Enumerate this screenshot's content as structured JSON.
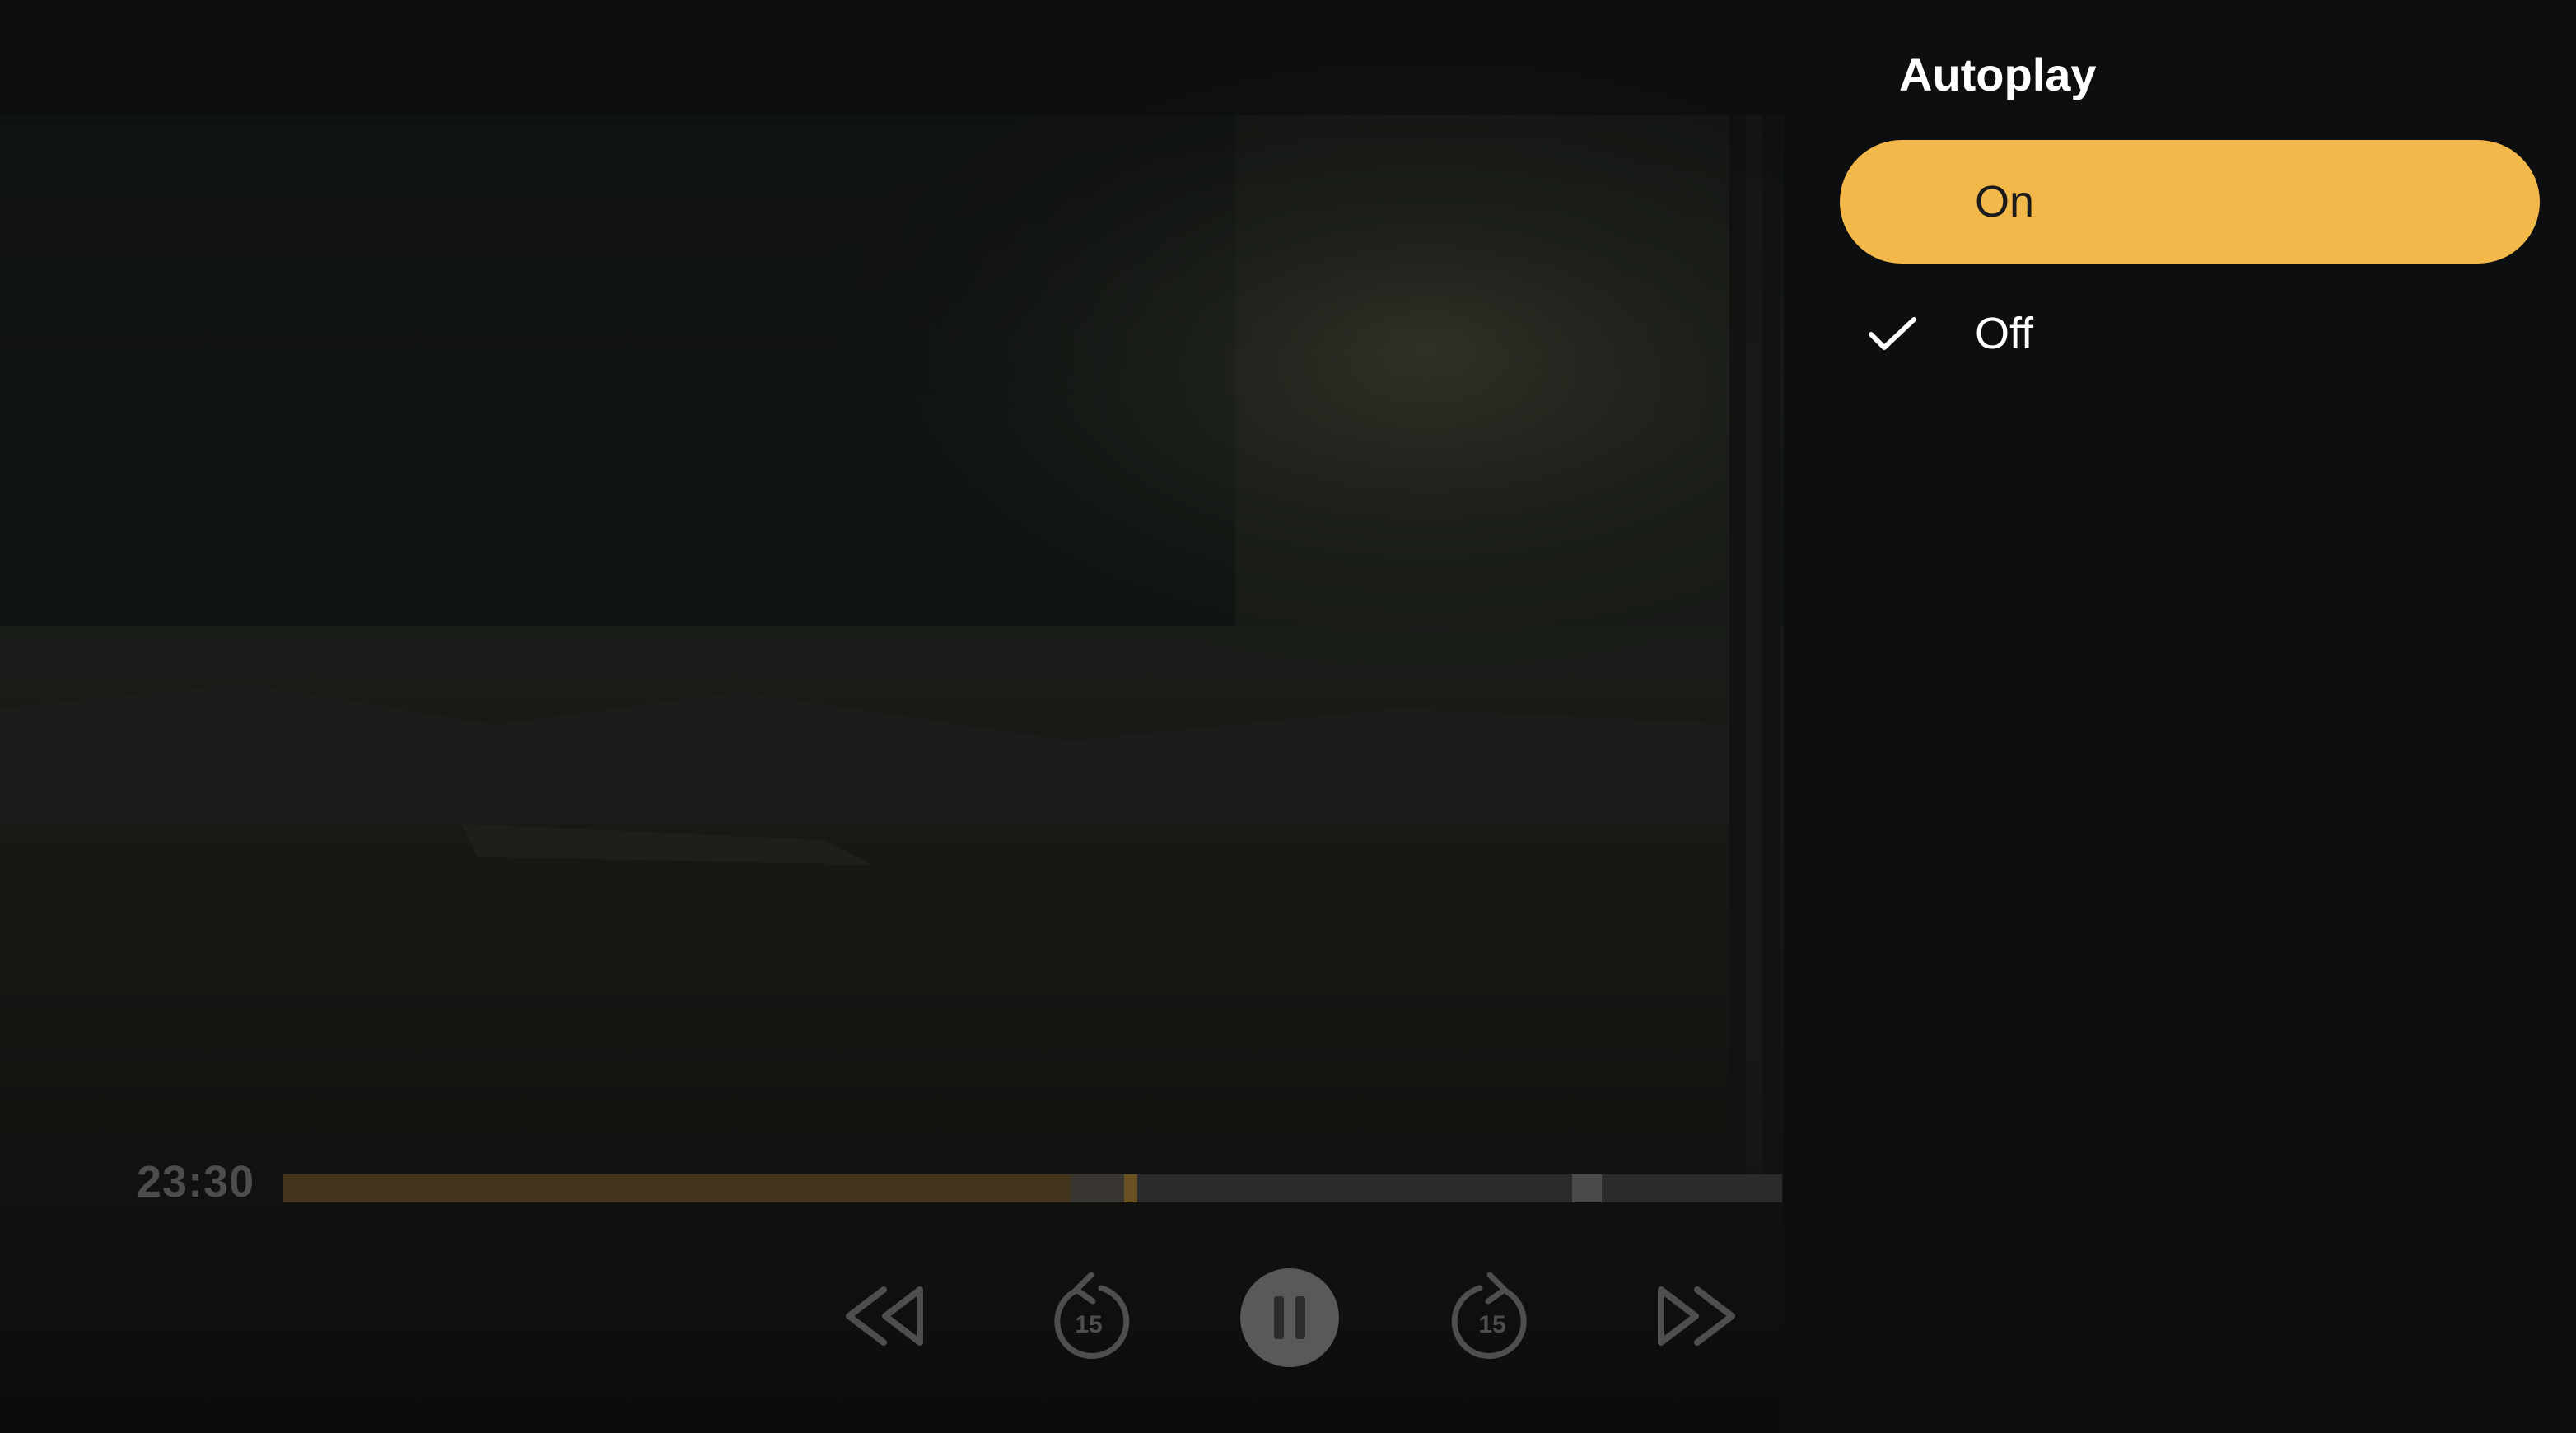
{
  "player": {
    "current_time": "23:30",
    "progress_fraction": 0.525,
    "buffered_fraction": 0.57,
    "marker_fraction": 0.86,
    "controls": {
      "rewind": "rewind-icon",
      "skip_back": "skip-back-15-icon",
      "skip_back_seconds": "15",
      "pause": "pause-icon",
      "skip_forward": "skip-forward-15-icon",
      "skip_forward_seconds": "15",
      "fast_forward": "fast-forward-icon"
    }
  },
  "autoplay_panel": {
    "title": "Autoplay",
    "options": [
      {
        "label": "On",
        "focused": true,
        "selected": false
      },
      {
        "label": "Off",
        "focused": false,
        "selected": true
      }
    ],
    "selected_icon": "checkmark-icon"
  },
  "colors": {
    "accent": "#f2b84a",
    "panel_background": "#0d0e10",
    "title_text": "#ffffff"
  }
}
